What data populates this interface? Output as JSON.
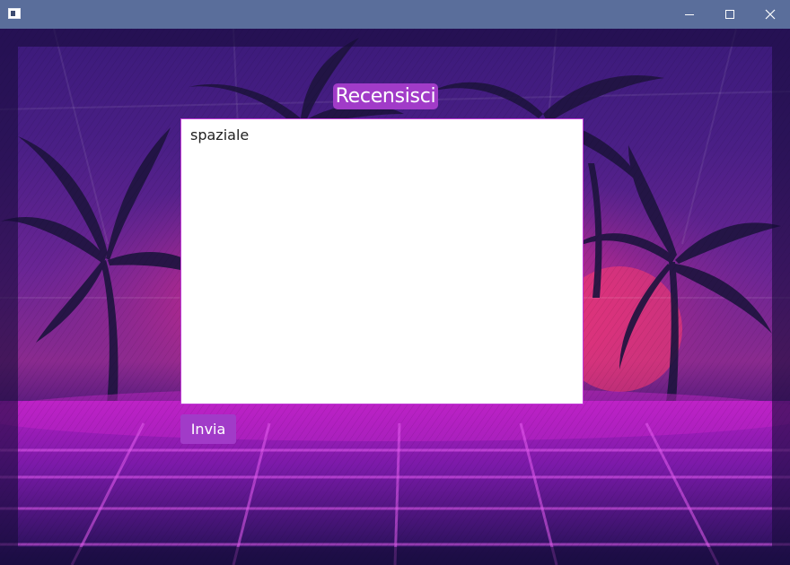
{
  "window": {
    "icons": {
      "app": "app-window-icon",
      "minimize": "minimize-icon",
      "maximize": "maximize-icon",
      "close": "close-icon"
    }
  },
  "form": {
    "heading": "Recensisci",
    "review_value": "spaziale",
    "submit_label": "Invia"
  },
  "colors": {
    "accent": "#a13bc8",
    "titlebar": "#5a6e9b",
    "text_area_border": "#c03ad6"
  }
}
